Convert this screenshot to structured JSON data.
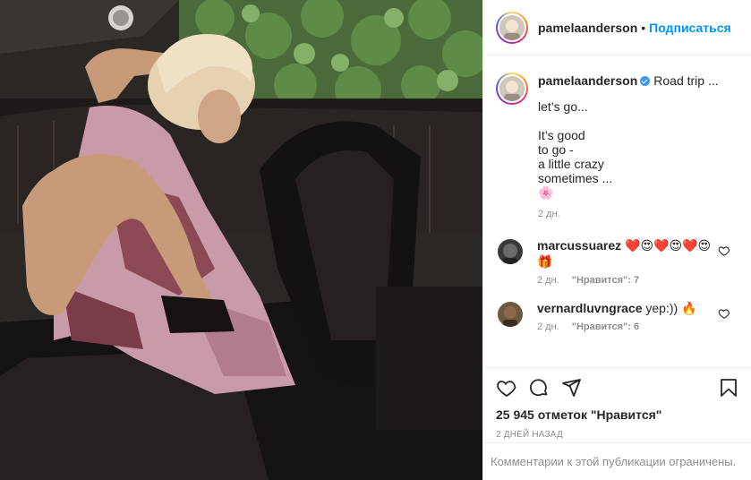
{
  "photo": {
    "alt_icon": "photo-image"
  },
  "header": {
    "username": "pamelaanderson",
    "dot": "•",
    "follow_label": "Подписаться"
  },
  "caption": {
    "username": "pamelaanderson",
    "lead": "Road trip ...",
    "body": "let’s go...\n\nIt’s good\nto go -\na little crazy\nsometimes ...\n🌸",
    "time": "2 дн."
  },
  "comments": [
    {
      "username": "marcussuarez",
      "text": "❤️😍❤️😍❤️😍🎁",
      "time": "2 дн.",
      "likes": "\"Нравится\": 7"
    },
    {
      "username": "vernardluvngrace",
      "text": "yep:)) 🔥",
      "time": "2 дн.",
      "likes": "\"Нравится\": 6"
    }
  ],
  "actions": {
    "likes_count": "25 945 отметок \"Нравится\"",
    "posted_ago": "2 дней назад"
  },
  "footer": {
    "restricted_text": "Комментарии к этой публикации ограничены."
  },
  "colors": {
    "accent": "#0095f6",
    "muted": "#8e8e8e",
    "text": "#262626",
    "verified": "#3897f0"
  }
}
